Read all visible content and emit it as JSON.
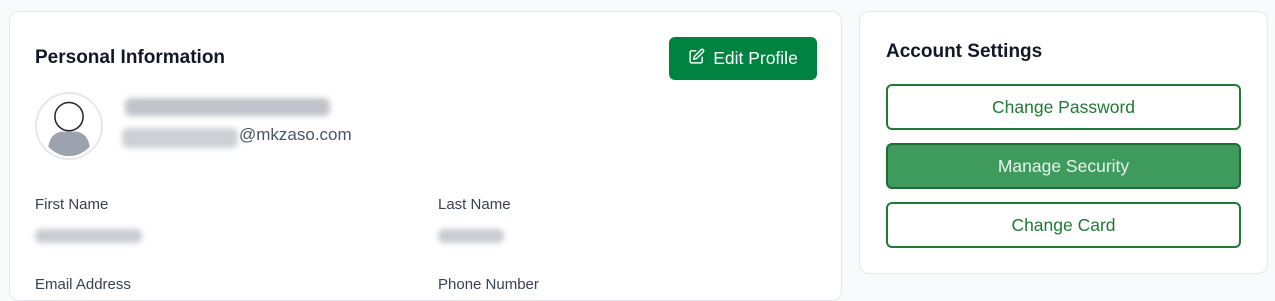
{
  "personal": {
    "title": "Personal Information",
    "edit_label": "Edit Profile",
    "user_name": "",
    "email_local": "",
    "email_domain": "@mkzaso.com",
    "fields": {
      "first_name_label": "First Name",
      "first_name_value": "",
      "last_name_label": "Last Name",
      "last_name_value": "",
      "email_label": "Email Address",
      "phone_label": "Phone Number"
    }
  },
  "account": {
    "title": "Account Settings",
    "buttons": {
      "change_password": "Change Password",
      "manage_security": "Manage Security",
      "change_card": "Change Card"
    }
  },
  "colors": {
    "primary": "#008341",
    "outline": "#1e7a34",
    "active_fill": "#3f9a5e"
  },
  "icons": {
    "edit": "edit-icon",
    "avatar": "user-avatar-icon"
  }
}
